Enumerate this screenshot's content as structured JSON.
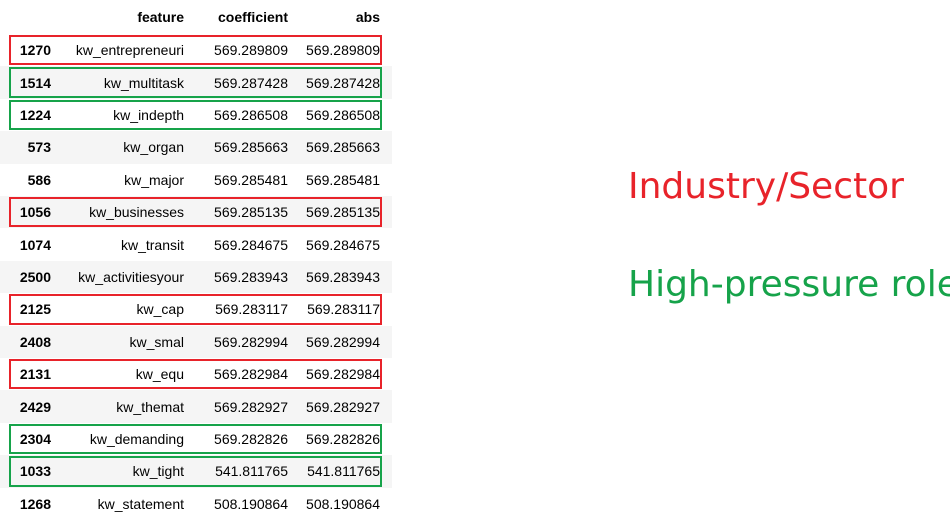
{
  "table": {
    "columns": [
      "feature",
      "coefficient",
      "abs"
    ],
    "rows": [
      {
        "index": "1270",
        "feature": "kw_entrepreneuri",
        "coefficient": "569.289809",
        "abs": "569.289809",
        "highlight": "red"
      },
      {
        "index": "1514",
        "feature": "kw_multitask",
        "coefficient": "569.287428",
        "abs": "569.287428",
        "highlight": "green"
      },
      {
        "index": "1224",
        "feature": "kw_indepth",
        "coefficient": "569.286508",
        "abs": "569.286508",
        "highlight": "green"
      },
      {
        "index": "573",
        "feature": "kw_organ",
        "coefficient": "569.285663",
        "abs": "569.285663",
        "highlight": ""
      },
      {
        "index": "586",
        "feature": "kw_major",
        "coefficient": "569.285481",
        "abs": "569.285481",
        "highlight": ""
      },
      {
        "index": "1056",
        "feature": "kw_businesses",
        "coefficient": "569.285135",
        "abs": "569.285135",
        "highlight": "red"
      },
      {
        "index": "1074",
        "feature": "kw_transit",
        "coefficient": "569.284675",
        "abs": "569.284675",
        "highlight": ""
      },
      {
        "index": "2500",
        "feature": "kw_activitiesyour",
        "coefficient": "569.283943",
        "abs": "569.283943",
        "highlight": ""
      },
      {
        "index": "2125",
        "feature": "kw_cap",
        "coefficient": "569.283117",
        "abs": "569.283117",
        "highlight": "red"
      },
      {
        "index": "2408",
        "feature": "kw_smal",
        "coefficient": "569.282994",
        "abs": "569.282994",
        "highlight": ""
      },
      {
        "index": "2131",
        "feature": "kw_equ",
        "coefficient": "569.282984",
        "abs": "569.282984",
        "highlight": "red"
      },
      {
        "index": "2429",
        "feature": "kw_themat",
        "coefficient": "569.282927",
        "abs": "569.282927",
        "highlight": ""
      },
      {
        "index": "2304",
        "feature": "kw_demanding",
        "coefficient": "569.282826",
        "abs": "569.282826",
        "highlight": "green"
      },
      {
        "index": "1033",
        "feature": "kw_tight",
        "coefficient": "541.811765",
        "abs": "541.811765",
        "highlight": "green"
      },
      {
        "index": "1268",
        "feature": "kw_statement",
        "coefficient": "508.190864",
        "abs": "508.190864",
        "highlight": ""
      }
    ]
  },
  "legend": [
    {
      "label": "Industry/Sector",
      "color": "#e8232a"
    },
    {
      "label": "High-pressure roles",
      "color": "#16a34a"
    }
  ]
}
